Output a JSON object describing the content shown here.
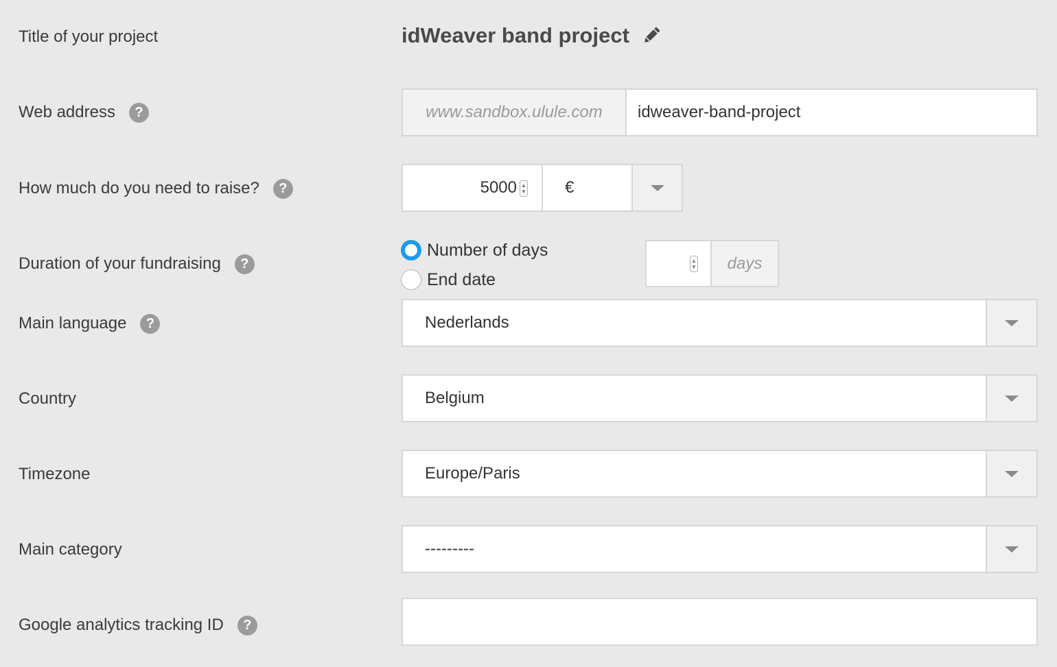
{
  "title": {
    "label": "Title of your project",
    "value": "idWeaver band project"
  },
  "web_address": {
    "label": "Web address",
    "prefix": "www.sandbox.ulule.com",
    "value": "idweaver-band-project"
  },
  "goal": {
    "label": "How much do you need to raise?",
    "amount": "5000",
    "currency": "€"
  },
  "duration": {
    "label": "Duration of your fundraising",
    "options": [
      "Number of days",
      "End date"
    ],
    "selected": "Number of days",
    "days_value": "",
    "days_unit": "days"
  },
  "language": {
    "label": "Main language",
    "value": "Nederlands"
  },
  "country": {
    "label": "Country",
    "value": "Belgium"
  },
  "timezone": {
    "label": "Timezone",
    "value": "Europe/Paris"
  },
  "category": {
    "label": "Main category",
    "value": "---------"
  },
  "analytics": {
    "label": "Google analytics tracking ID",
    "value": ""
  },
  "icons": {
    "help": "?"
  },
  "colors": {
    "background": "#e9e9e9",
    "radio_accent": "#1a9bf0",
    "help_icon": "#9b9b9b"
  }
}
